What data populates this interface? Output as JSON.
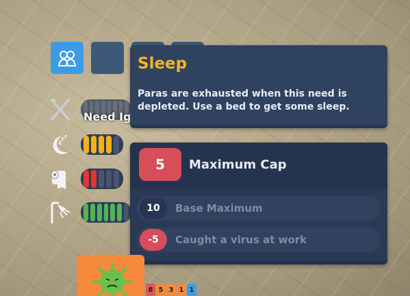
{
  "hud": {
    "tabs": [
      {
        "name": "paras-tab",
        "icon": "people-icon",
        "active": true
      },
      {
        "name": "tab-2",
        "active": false
      },
      {
        "name": "tab-3",
        "active": false
      },
      {
        "name": "tab-4",
        "active": false
      }
    ]
  },
  "needs": {
    "hover_label": "Need Ig",
    "rows": [
      {
        "icon": "fork-knife-icon",
        "level": 0,
        "segments": 8,
        "color": "#4a5670"
      },
      {
        "icon": "sleep-moon-icon",
        "level": 4,
        "segments": 5,
        "color": "#f2b21a"
      },
      {
        "icon": "toilet-paper-icon",
        "level": 2,
        "segments": 5,
        "color": "#e33535"
      },
      {
        "icon": "shower-icon",
        "level": 6,
        "segments": 7,
        "color": "#52b35a"
      }
    ]
  },
  "tooltip": {
    "title": "Sleep",
    "description": "Paras are exhausted when this need is depleted. Use a bed to get some sleep."
  },
  "cap": {
    "value": "5",
    "title": "Maximum Cap",
    "modifiers": [
      {
        "value": "10",
        "label": "Base Maximum",
        "kind": "pos"
      },
      {
        "value": "-5",
        "label": "Caught a virus at work",
        "kind": "neg"
      }
    ]
  },
  "virus_card": {
    "icon": "virus-icon",
    "tags": [
      {
        "text": "8",
        "color": "#e25757"
      },
      {
        "text": "5",
        "color": "#f7893d"
      },
      {
        "text": "3",
        "color": "#f7893d"
      },
      {
        "text": "1",
        "color": "#f7893d"
      },
      {
        "text": "1",
        "color": "#3d9be6"
      }
    ]
  }
}
